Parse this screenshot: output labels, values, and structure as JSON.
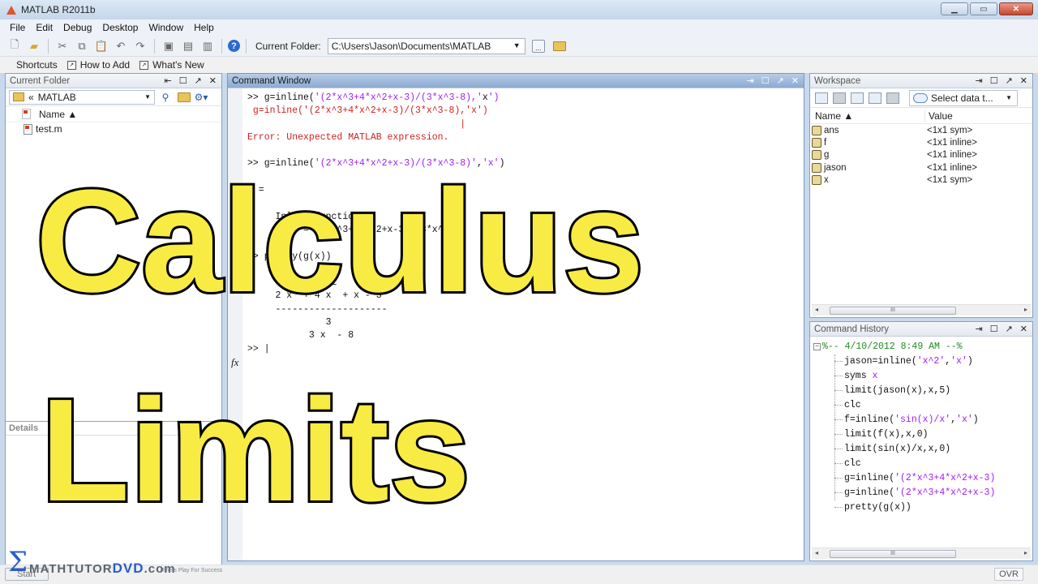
{
  "window": {
    "title": "MATLAB  R2011b",
    "controls": [
      "minimize",
      "maximize",
      "close"
    ]
  },
  "menubar": {
    "items": [
      "File",
      "Edit",
      "Debug",
      "Desktop",
      "Window",
      "Help"
    ]
  },
  "toolbar": {
    "icons": [
      "new-file-icon",
      "open-folder-icon",
      "cut-icon",
      "copy-icon",
      "paste-icon",
      "undo-icon",
      "redo-icon",
      "simulink-icon",
      "guide-icon",
      "profiler-icon",
      "help-icon"
    ],
    "current_folder_label": "Current Folder:",
    "current_folder_path": "C:\\Users\\Jason\\Documents\\MATLAB",
    "browse_label": "..."
  },
  "shortcuts": {
    "label": "Shortcuts",
    "items": [
      "How to Add",
      "What's New"
    ]
  },
  "current_folder_panel": {
    "title": "Current Folder",
    "address": "MATLAB",
    "address_prefix": "«",
    "column_name": "Name ▲",
    "files": [
      "test.m"
    ],
    "details_label": "Details"
  },
  "command_window": {
    "title": "Command Window",
    "lines": [
      [
        {
          "t": ">> g=inline(",
          "c": "k"
        },
        {
          "t": "'(2*x^3+4*x^2+x-3)/(3*x^3-8),'",
          "c": "s"
        },
        {
          "t": "x",
          "c": "k"
        },
        {
          "t": "')",
          "c": "s"
        }
      ],
      [
        {
          "t": " g=inline('(2*x^3+4*x^2+x-3)/(3*x^3-8),'x')",
          "c": "e"
        }
      ],
      [
        {
          "t": "                                      |",
          "c": "e"
        }
      ],
      [
        {
          "t": "Error: Unexpected MATLAB expression.",
          "c": "e"
        }
      ],
      [
        {
          "t": "",
          "c": "k"
        }
      ],
      [
        {
          "t": ">> g=inline(",
          "c": "k"
        },
        {
          "t": "'(2*x^3+4*x^2+x-3)/(3*x^3-8)'",
          "c": "s"
        },
        {
          "t": ",",
          "c": "k"
        },
        {
          "t": "'x'",
          "c": "s"
        },
        {
          "t": ")",
          "c": "k"
        }
      ],
      [
        {
          "t": "",
          "c": "k"
        }
      ],
      [
        {
          "t": "g =",
          "c": "k"
        }
      ],
      [
        {
          "t": "",
          "c": "k"
        }
      ],
      [
        {
          "t": "     Inline function:",
          "c": "k"
        }
      ],
      [
        {
          "t": "     g(x) = (2*x^3+4*x^2+x-3)/(3*x^3-8)",
          "c": "k"
        }
      ],
      [
        {
          "t": "",
          "c": "k"
        }
      ],
      [
        {
          "t": ">> pretty(g(x))",
          "c": "k"
        }
      ],
      [
        {
          "t": "",
          "c": "k"
        }
      ],
      [
        {
          "t": "        3      2",
          "c": "k"
        }
      ],
      [
        {
          "t": "     2 x  + 4 x  + x - 3",
          "c": "k"
        }
      ],
      [
        {
          "t": "     --------------------",
          "c": "k"
        }
      ],
      [
        {
          "t": "              3",
          "c": "k"
        }
      ],
      [
        {
          "t": "           3 x  - 8",
          "c": "k"
        }
      ]
    ],
    "prompt": ">> "
  },
  "workspace": {
    "title": "Workspace",
    "select_data_label": "Select data t...",
    "columns": [
      "Name ▲",
      "Value"
    ],
    "rows": [
      {
        "name": "ans",
        "value": "<1x1 sym>"
      },
      {
        "name": "f",
        "value": "<1x1 inline>"
      },
      {
        "name": "g",
        "value": "<1x1 inline>"
      },
      {
        "name": "jason",
        "value": "<1x1 inline>"
      },
      {
        "name": "x",
        "value": "<1x1 sym>"
      }
    ]
  },
  "command_history": {
    "title": "Command History",
    "session_header": "%-- 4/10/2012 8:49 AM --%",
    "items": [
      [
        {
          "t": "jason=inline(",
          "c": "k"
        },
        {
          "t": "'x^2'",
          "c": "s"
        },
        {
          "t": ",",
          "c": "k"
        },
        {
          "t": "'x'",
          "c": "s"
        },
        {
          "t": ")",
          "c": "k"
        }
      ],
      [
        {
          "t": "syms ",
          "c": "k"
        },
        {
          "t": "x",
          "c": "s"
        }
      ],
      [
        {
          "t": "limit(jason(x),x,5)",
          "c": "k"
        }
      ],
      [
        {
          "t": "clc",
          "c": "k"
        }
      ],
      [
        {
          "t": "f=inline(",
          "c": "k"
        },
        {
          "t": "'sin(x)/x'",
          "c": "s"
        },
        {
          "t": ",",
          "c": "k"
        },
        {
          "t": "'x'",
          "c": "s"
        },
        {
          "t": ")",
          "c": "k"
        }
      ],
      [
        {
          "t": "limit(f(x),x,0)",
          "c": "k"
        }
      ],
      [
        {
          "t": "limit(sin(x)/x,x,0)",
          "c": "k"
        }
      ],
      [
        {
          "t": "clc",
          "c": "k"
        }
      ],
      [
        {
          "t": "g=inline(",
          "c": "k"
        },
        {
          "t": "'(2*x^3+4*x^2+x-3)",
          "c": "s"
        }
      ],
      [
        {
          "t": "g=inline(",
          "c": "k"
        },
        {
          "t": "'(2*x^3+4*x^2+x-3)",
          "c": "s"
        }
      ],
      [
        {
          "t": "pretty(g(x))",
          "c": "k"
        }
      ]
    ]
  },
  "statusbar": {
    "start_label": "Start",
    "ovr_label": "OVR"
  },
  "overlay": {
    "line1": "Calculus",
    "line2": "Limits",
    "brand_main": "MATHTUTOR",
    "brand_dvd": "DVD",
    "brand_com": ".com",
    "tagline": "Press Play For Success",
    "color_fill": "#f8eb44",
    "color_stroke": "#000000"
  }
}
